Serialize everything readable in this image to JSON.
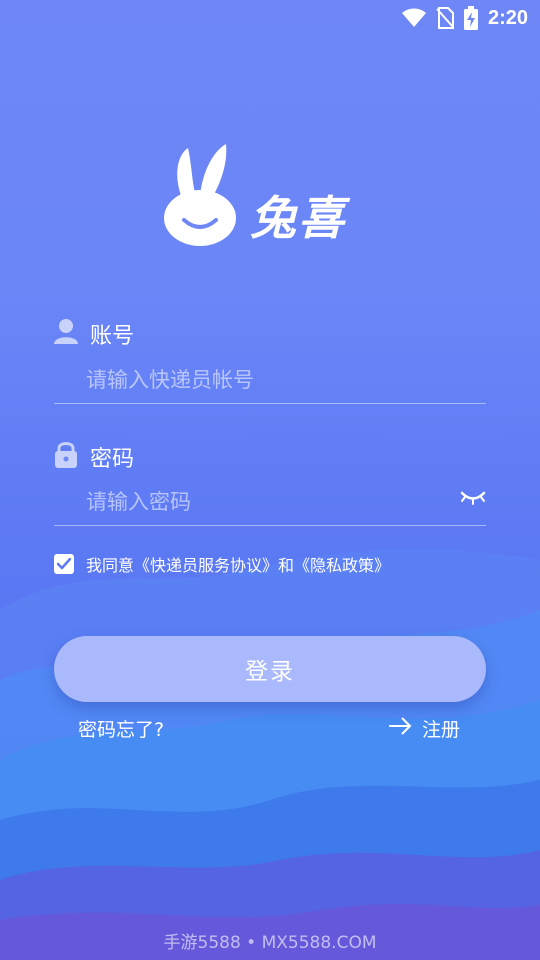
{
  "status_bar": {
    "time": "2:20",
    "icons": [
      "wifi-icon",
      "no-sim-icon",
      "battery-charging-icon"
    ]
  },
  "logo": {
    "icon": "rabbit-logo-icon",
    "text": "兔喜"
  },
  "account": {
    "icon": "user-icon",
    "label": "账号",
    "placeholder": "请输入快递员帐号",
    "value": ""
  },
  "password": {
    "icon": "lock-icon",
    "label": "密码",
    "placeholder": "请输入密码",
    "value": "",
    "toggle_icon": "eye-closed-icon"
  },
  "agreement": {
    "checked": true,
    "text": "我同意《快递员服务协议》和《隐私政策》"
  },
  "login_button": {
    "label": "登录"
  },
  "forgot_link": {
    "label": "密码忘了?"
  },
  "register_link": {
    "label": "注册",
    "icon": "arrow-right-icon"
  },
  "watermark": "手游5588 • MX5588.COM",
  "colors": {
    "background_top": "#6f87f6",
    "background_bottom": "#4f6ef0",
    "button": "#aab9fb",
    "text": "#ffffff"
  }
}
